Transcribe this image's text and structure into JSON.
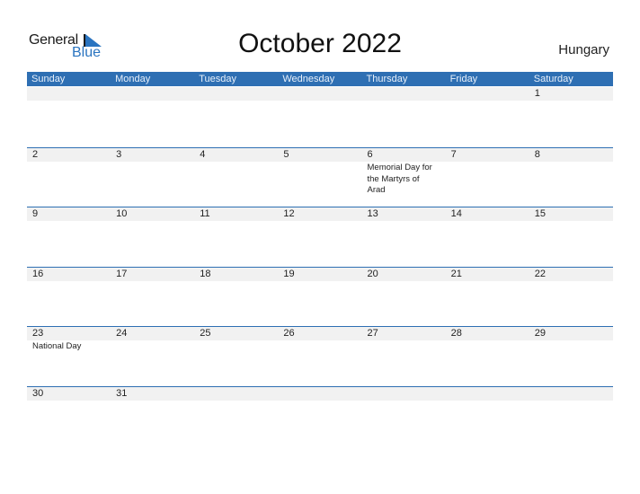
{
  "logo": {
    "word1": "General",
    "word2": "Blue"
  },
  "title": "October 2022",
  "country": "Hungary",
  "colors": {
    "accent": "#2e6fb3",
    "day_strip": "#f1f1f1"
  },
  "weekdays": [
    "Sunday",
    "Monday",
    "Tuesday",
    "Wednesday",
    "Thursday",
    "Friday",
    "Saturday"
  ],
  "weeks": [
    [
      {
        "day": ""
      },
      {
        "day": ""
      },
      {
        "day": ""
      },
      {
        "day": ""
      },
      {
        "day": ""
      },
      {
        "day": ""
      },
      {
        "day": "1"
      }
    ],
    [
      {
        "day": "2"
      },
      {
        "day": "3"
      },
      {
        "day": "4"
      },
      {
        "day": "5"
      },
      {
        "day": "6",
        "event": "Memorial Day for the Martyrs of Arad"
      },
      {
        "day": "7"
      },
      {
        "day": "8"
      }
    ],
    [
      {
        "day": "9"
      },
      {
        "day": "10"
      },
      {
        "day": "11"
      },
      {
        "day": "12"
      },
      {
        "day": "13"
      },
      {
        "day": "14"
      },
      {
        "day": "15"
      }
    ],
    [
      {
        "day": "16"
      },
      {
        "day": "17"
      },
      {
        "day": "18"
      },
      {
        "day": "19"
      },
      {
        "day": "20"
      },
      {
        "day": "21"
      },
      {
        "day": "22"
      }
    ],
    [
      {
        "day": "23",
        "event": "National Day"
      },
      {
        "day": "24"
      },
      {
        "day": "25"
      },
      {
        "day": "26"
      },
      {
        "day": "27"
      },
      {
        "day": "28"
      },
      {
        "day": "29"
      }
    ],
    [
      {
        "day": "30"
      },
      {
        "day": "31"
      },
      {
        "day": ""
      },
      {
        "day": ""
      },
      {
        "day": ""
      },
      {
        "day": ""
      },
      {
        "day": ""
      }
    ]
  ]
}
